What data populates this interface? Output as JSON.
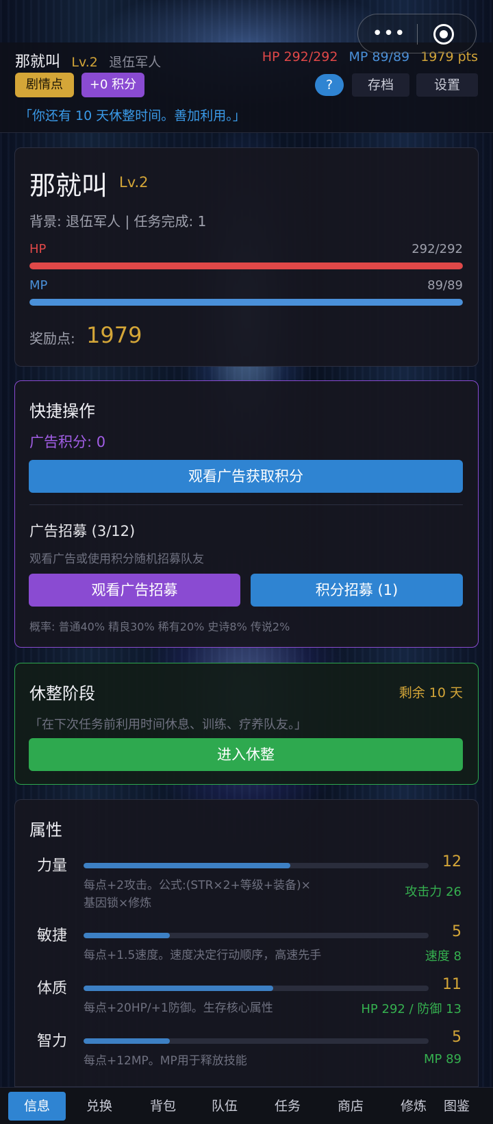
{
  "player": {
    "name": "那就叫",
    "level": "Lv.2",
    "background": "退伍军人"
  },
  "header": {
    "hp": "HP 292/292",
    "mp": "MP 89/89",
    "points": "1979 pts",
    "plot_chip": "剧情点",
    "points_chip": "+0 积分",
    "help_label": "?",
    "save_label": "存档",
    "settings_label": "设置",
    "quote": "「你还有 10 天休整时间。善加利用。」"
  },
  "character": {
    "name": "那就叫",
    "level": "Lv.2",
    "meta": "背景: 退伍军人 | 任务完成: 1",
    "hp_label": "HP",
    "hp_value": "292/292",
    "hp_fraction": 1.0,
    "mp_label": "MP",
    "mp_value": "89/89",
    "mp_fraction": 1.0,
    "reward_label": "奖励点:",
    "reward_value": "1979"
  },
  "quick_actions": {
    "title": "快捷操作",
    "ad_points": "广告积分: 0",
    "watch_ad_button": "观看广告获取积分",
    "recruit_title": "广告招募 (3/12)",
    "recruit_hint": "观看广告或使用积分随机招募队友",
    "ad_recruit_button": "观看广告招募",
    "points_recruit_button": "积分招募 (1)",
    "rates": "概率: 普通40% 精良30% 稀有20% 史诗8% 传说2%"
  },
  "rest": {
    "title": "休整阶段",
    "remaining": "剩余 10 天",
    "quote": "「在下次任务前利用时间休息、训练、疗养队友。」",
    "enter_button": "进入休整"
  },
  "attributes": {
    "title": "属性",
    "items": [
      {
        "name": "力量",
        "value": "12",
        "fraction": 0.6,
        "desc": "每点+2攻击。公式:(STR×2+等级+装备)×基因锁×修炼",
        "effect": "攻击力 26"
      },
      {
        "name": "敏捷",
        "value": "5",
        "fraction": 0.25,
        "desc": "每点+1.5速度。速度决定行动顺序，高速先手",
        "effect": "速度 8"
      },
      {
        "name": "体质",
        "value": "11",
        "fraction": 0.55,
        "desc": "每点+20HP/+1防御。生存核心属性",
        "effect": "HP 292 / 防御 13"
      },
      {
        "name": "智力",
        "value": "5",
        "fraction": 0.25,
        "desc": "每点+12MP。MP用于释放技能",
        "effect": "MP 89"
      }
    ]
  },
  "nav": {
    "items": [
      "信息",
      "兑换",
      "背包",
      "队伍",
      "任务",
      "商店",
      "修炼",
      "图鉴"
    ],
    "active": "信息"
  },
  "colors": {
    "gold": "#d4a638",
    "hp_red": "#e04848",
    "mp_blue": "#4a90d9",
    "accent_blue": "#2f84d2",
    "accent_purple": "#8a4bd2",
    "accent_green": "#2ea94f"
  }
}
